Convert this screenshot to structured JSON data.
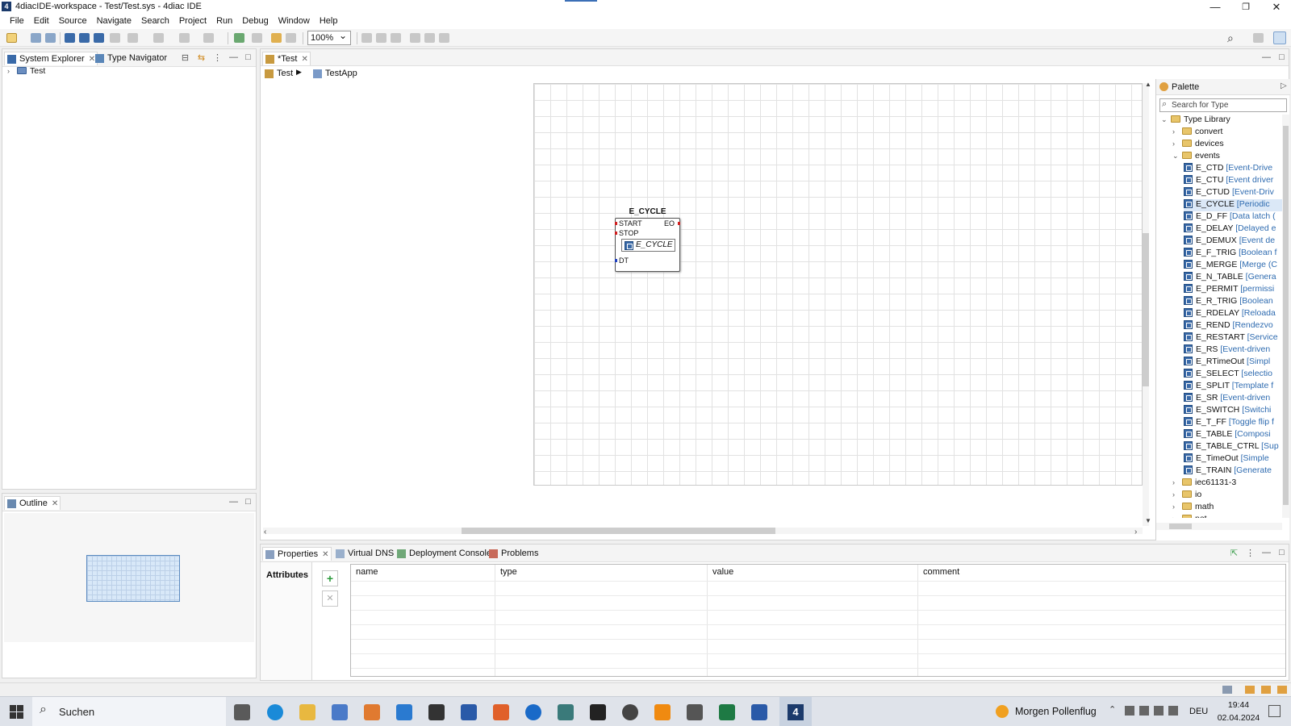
{
  "window": {
    "title": "4diacIDE-workspace - Test/Test.sys - 4diac IDE",
    "minimize": "—",
    "restore": "❐",
    "close": "✕"
  },
  "menu": [
    "File",
    "Edit",
    "Source",
    "Navigate",
    "Search",
    "Project",
    "Run",
    "Debug",
    "Window",
    "Help"
  ],
  "toolbar": {
    "zoom": "100%"
  },
  "left_panel": {
    "tabs": [
      "System Explorer",
      "Type Navigator"
    ],
    "tree": [
      {
        "label": "Test"
      }
    ]
  },
  "outline": {
    "tab": "Outline"
  },
  "editor": {
    "tab": "*Test",
    "breadcrumb": [
      "Test",
      "TestApp"
    ],
    "fb": {
      "instance_name": "E_CYCLE",
      "type_name": "E_CYCLE",
      "inputs": [
        "START",
        "STOP"
      ],
      "outputs": [
        "EO"
      ],
      "data_inputs": [
        "DT"
      ]
    }
  },
  "palette": {
    "title": "Palette",
    "search_placeholder": "Search for Type",
    "root": "Type Library",
    "folders_before": [
      "convert",
      "devices"
    ],
    "open_folder": "events",
    "items": [
      {
        "name": "E_CTD",
        "desc": "[Event-Drive"
      },
      {
        "name": "E_CTU",
        "desc": "[Event driver"
      },
      {
        "name": "E_CTUD",
        "desc": "[Event-Driv"
      },
      {
        "name": "E_CYCLE",
        "desc": "[Periodic "
      },
      {
        "name": "E_D_FF",
        "desc": "[Data latch ("
      },
      {
        "name": "E_DELAY",
        "desc": "[Delayed e"
      },
      {
        "name": "E_DEMUX",
        "desc": "[Event de"
      },
      {
        "name": "E_F_TRIG",
        "desc": "[Boolean f"
      },
      {
        "name": "E_MERGE",
        "desc": "[Merge (C"
      },
      {
        "name": "E_N_TABLE",
        "desc": "[Genera"
      },
      {
        "name": "E_PERMIT",
        "desc": "[permissi"
      },
      {
        "name": "E_R_TRIG",
        "desc": "[Boolean"
      },
      {
        "name": "E_RDELAY",
        "desc": "[Reloada"
      },
      {
        "name": "E_REND",
        "desc": "[Rendezvo"
      },
      {
        "name": "E_RESTART",
        "desc": "[Service"
      },
      {
        "name": "E_RS",
        "desc": "[Event-driven"
      },
      {
        "name": "E_RTimeOut",
        "desc": "[Simpl"
      },
      {
        "name": "E_SELECT",
        "desc": "[selectio"
      },
      {
        "name": "E_SPLIT",
        "desc": "[Template f"
      },
      {
        "name": "E_SR",
        "desc": "[Event-driven"
      },
      {
        "name": "E_SWITCH",
        "desc": "[Switchi"
      },
      {
        "name": "E_T_FF",
        "desc": "[Toggle flip f"
      },
      {
        "name": "E_TABLE",
        "desc": "[Composi"
      },
      {
        "name": "E_TABLE_CTRL",
        "desc": "[Sup"
      },
      {
        "name": "E_TimeOut",
        "desc": "[Simple"
      },
      {
        "name": "E_TRAIN",
        "desc": "[Generate"
      }
    ],
    "folders_after": [
      "iec61131-3",
      "io",
      "math",
      "net"
    ]
  },
  "bottom": {
    "tabs": [
      "Properties",
      "Virtual DNS",
      "Deployment Console",
      "Problems"
    ],
    "section": "Attributes",
    "columns": [
      "name",
      "type",
      "value",
      "comment"
    ]
  },
  "taskbar": {
    "search": "Suchen",
    "weather": "Morgen Pollenflug",
    "lang": "DEU",
    "time": "19:44",
    "date": "02.04.2024"
  }
}
